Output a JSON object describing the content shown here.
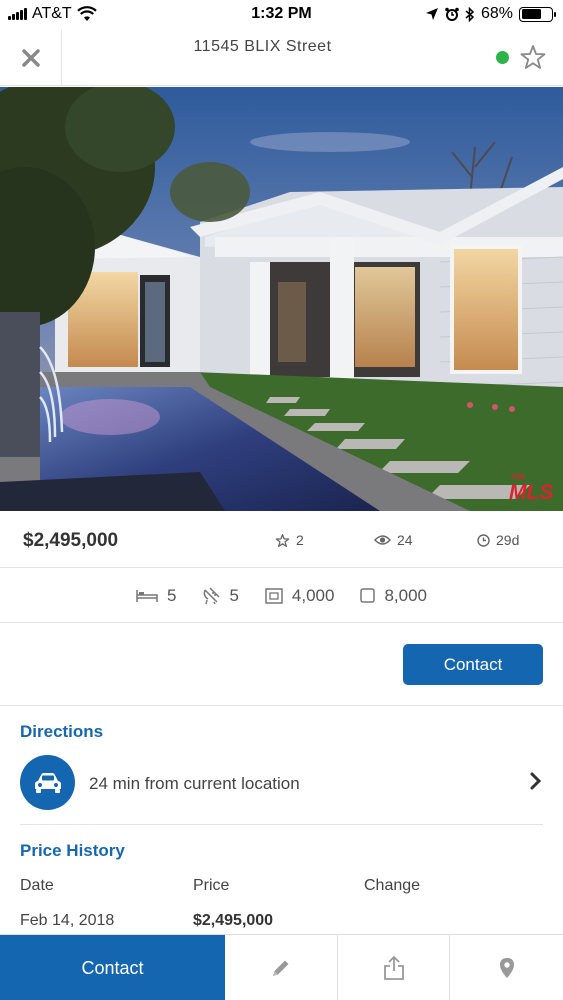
{
  "status_bar": {
    "carrier": "AT&T",
    "time": "1:32 PM",
    "battery_percent": "68%",
    "battery_level": 0.68
  },
  "header": {
    "title": "11545 BLIX Street",
    "status_color": "#2cb34a"
  },
  "listing": {
    "photo_badge": "The MLS",
    "price": "$2,495,000",
    "favorites": "2",
    "views": "24",
    "days_on_market": "29d"
  },
  "features": {
    "beds": "5",
    "baths": "5",
    "sqft": "4,000",
    "lot": "8,000"
  },
  "contact_label": "Contact",
  "directions": {
    "title": "Directions",
    "text": "24 min from current location"
  },
  "price_history": {
    "title": "Price History",
    "columns": [
      "Date",
      "Price",
      "Change"
    ],
    "rows": [
      {
        "date": "Feb 14, 2018",
        "price": "$2,495,000",
        "change": ""
      }
    ]
  },
  "bottom_bar": {
    "contact_label": "Contact"
  },
  "colors": {
    "accent": "#1566b0",
    "section_title": "#1867ae"
  }
}
